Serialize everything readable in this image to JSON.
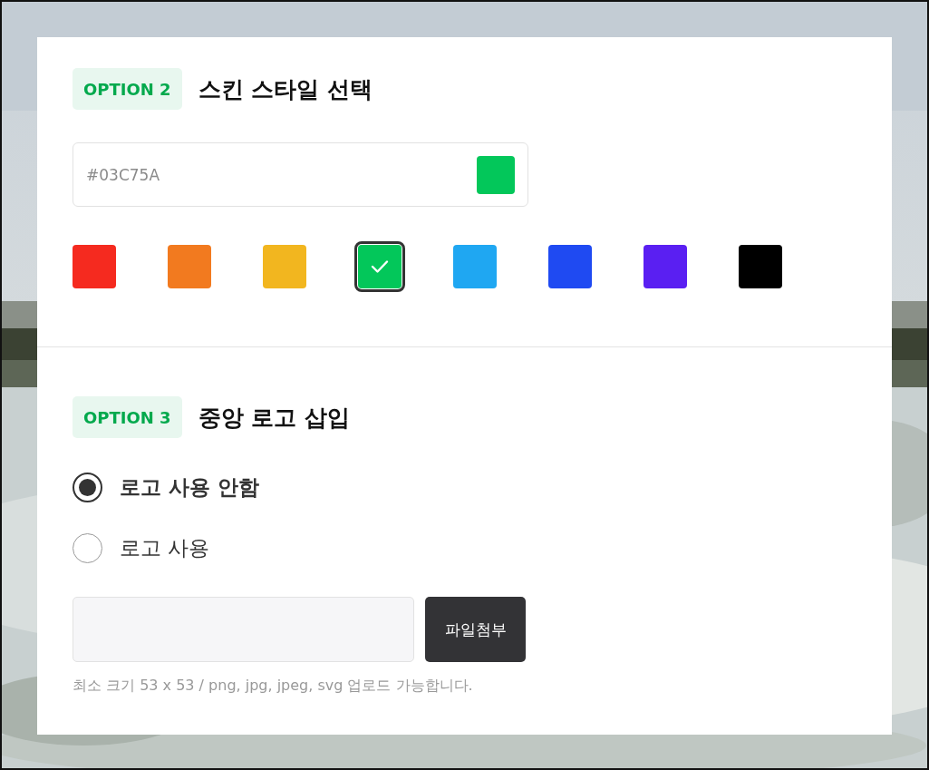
{
  "sections": [
    {
      "kind": "color",
      "badge": "OPTION 2",
      "title": "스킨 스타일 선택",
      "color_field": {
        "value": "#03C75A",
        "color": "#03c75a"
      },
      "swatches": [
        {
          "color": "#f52a1f",
          "selected": false
        },
        {
          "color": "#f27a1f",
          "selected": false
        },
        {
          "color": "#f2b61f",
          "selected": false
        },
        {
          "color": "#03c75a",
          "selected": true
        },
        {
          "color": "#1fa7f2",
          "selected": false
        },
        {
          "color": "#1f4af2",
          "selected": false
        },
        {
          "color": "#5a1ff2",
          "selected": false
        },
        {
          "color": "#000000",
          "selected": false
        }
      ]
    },
    {
      "kind": "logo",
      "badge": "OPTION 3",
      "title": "중앙 로고 삽입",
      "radios": [
        {
          "label": "로고 사용 안함",
          "selected": true
        },
        {
          "label": "로고 사용",
          "selected": false
        }
      ],
      "file_button": "파일첨부",
      "hint": "최소 크기 53 x 53 / png, jpg, jpeg, svg 업로드 가능합니다."
    }
  ]
}
